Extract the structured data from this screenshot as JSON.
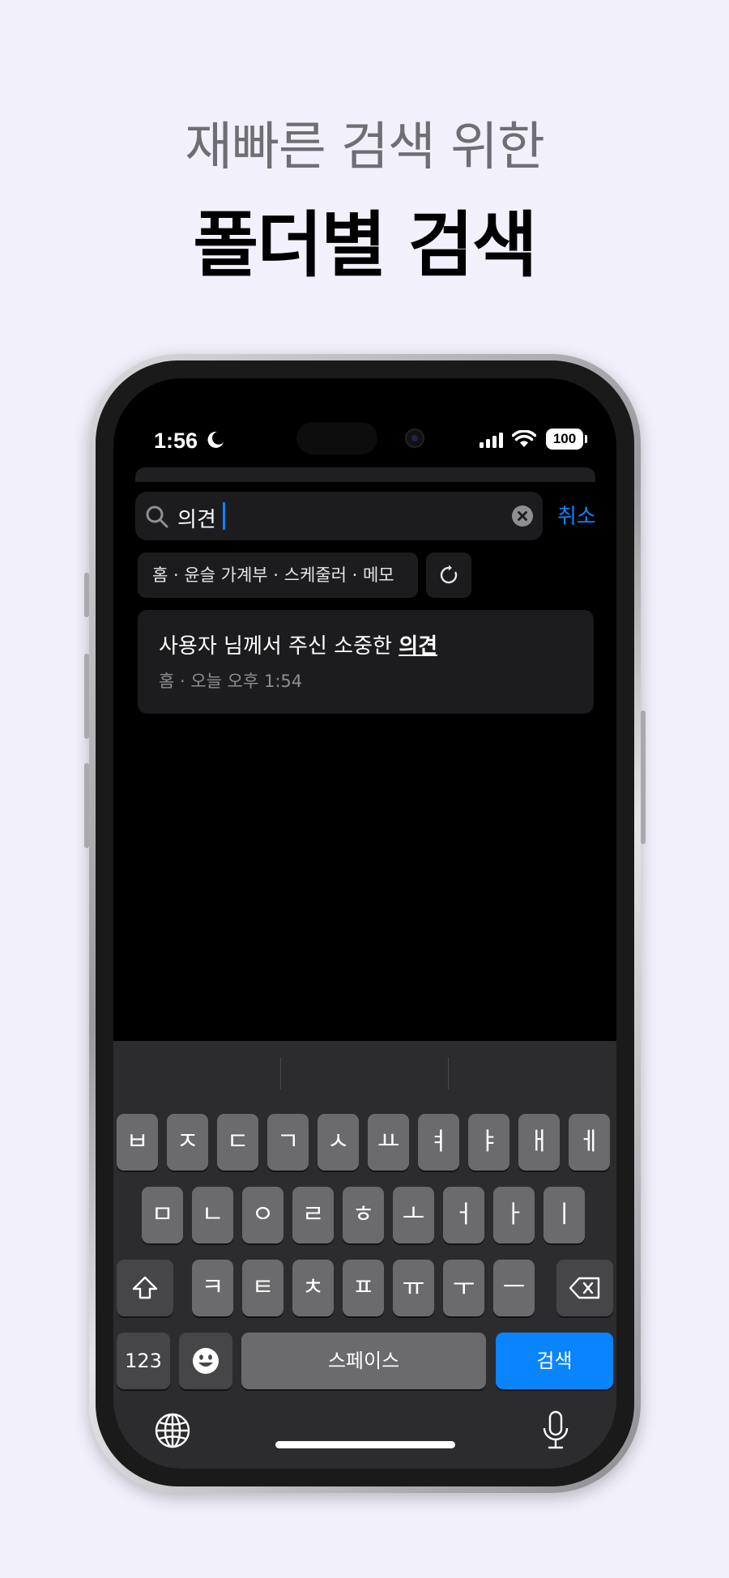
{
  "promo": {
    "subtitle": "재빠른 검색 위한",
    "title": "폴더별 검색"
  },
  "status_bar": {
    "time": "1:56",
    "battery": "100"
  },
  "search": {
    "value": "의견",
    "cancel_label": "취소"
  },
  "filter": {
    "chip_label": "홈 · 윤슬 가계부 · 스케줄러 · 메모"
  },
  "results": [
    {
      "title_prefix": "사용자 님께서 주신 소중한 ",
      "title_highlight": "의견",
      "meta": "홈 · 오늘 오후 1:54"
    }
  ],
  "keyboard": {
    "row1": [
      "ㅂ",
      "ㅈ",
      "ㄷ",
      "ㄱ",
      "ㅅ",
      "ㅛ",
      "ㅕ",
      "ㅑ",
      "ㅐ",
      "ㅔ"
    ],
    "row2": [
      "ㅁ",
      "ㄴ",
      "ㅇ",
      "ㄹ",
      "ㅎ",
      "ㅗ",
      "ㅓ",
      "ㅏ",
      "ㅣ"
    ],
    "row3": [
      "ㅋ",
      "ㅌ",
      "ㅊ",
      "ㅍ",
      "ㅠ",
      "ㅜ",
      "ㅡ"
    ],
    "numbers_label": "123",
    "space_label": "스페이스",
    "search_label": "검색"
  },
  "colors": {
    "accent": "#0a84ff",
    "background": "#f2f1fb"
  }
}
